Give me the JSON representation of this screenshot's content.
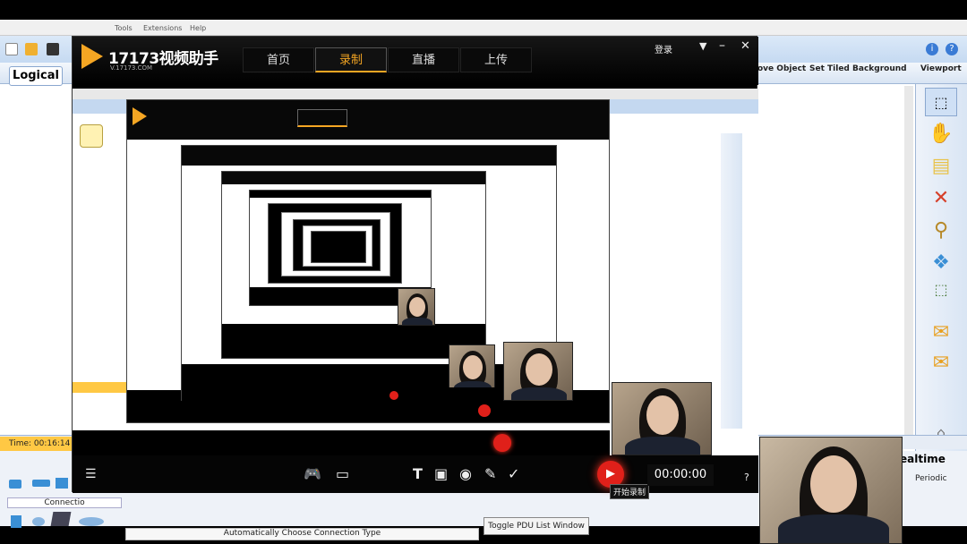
{
  "background_app": {
    "menu": [
      "Tools",
      "Extensions",
      "Help"
    ],
    "logical_tab": "Logical",
    "right_links": [
      "ove Object",
      "Set Tiled Background",
      "Viewport"
    ],
    "time": "Time: 00:16:14",
    "connections_label": "Connectio",
    "auto_connection": "Automatically Choose Connection Type",
    "toggle_pdu": "Toggle PDU List Window",
    "realtime": "ealtime",
    "periodic": "Periodic",
    "accent": "#ffc844"
  },
  "recorder": {
    "logo_text": "17173视频助手",
    "logo_sub": "V.17173.COM",
    "tabs": [
      "首页",
      "录制",
      "直播",
      "上传"
    ],
    "active_tab": "录制",
    "login": "登录",
    "record_tooltip": "开始录制",
    "timer": "00:00:00",
    "help": "?",
    "record_color": "#e0201a",
    "brand_color": "#f5a623"
  },
  "icons": [
    "menu-icon",
    "gamepad-icon",
    "monitor-icon",
    "text-icon",
    "image-icon",
    "webcam-icon",
    "brush-icon",
    "stamp-icon",
    "record-icon",
    "close-icon",
    "minimize-icon",
    "dropdown-icon"
  ]
}
